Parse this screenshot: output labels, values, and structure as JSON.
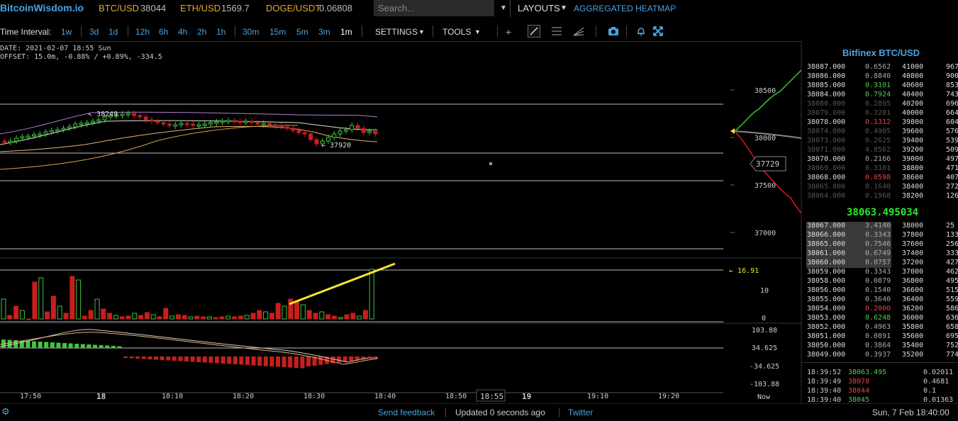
{
  "topbar": {
    "logo": "BitcoinWisdom.io",
    "tickers": [
      {
        "pair": "BTC/USD",
        "price": "38044"
      },
      {
        "pair": "ETH/USD",
        "price": "1569.7"
      },
      {
        "pair": "DOGE/USDT",
        "price": "0.06808"
      }
    ],
    "search_placeholder": "Search...",
    "layouts_label": "LAYOUTS",
    "heatmap_label": "AGGREGATED HEATMAP"
  },
  "toolbar": {
    "time_interval_label": "Time Interval:",
    "intervals": [
      "1w",
      "3d",
      "1d",
      "12h",
      "6h",
      "4h",
      "2h",
      "1h",
      "30m",
      "15m",
      "5m",
      "3m",
      "1m"
    ],
    "selected_interval": "1m",
    "settings_label": "SETTINGS",
    "tools_label": "TOOLS"
  },
  "chart_info": {
    "date_line": "DATE: 2021-02-07 18:55 Sun",
    "offset_line": "OFFSET: 15.0m, -0.88% / +0.89%, -334.5"
  },
  "chart": {
    "price_axis": [
      "38500",
      "38000",
      "37500",
      "37000"
    ],
    "high_label": "38249",
    "low_label": "37920",
    "depth_price_label": "37729",
    "volume_axis": [
      "10",
      "0"
    ],
    "volume_marker": "16.91",
    "macd_axis": [
      "103.88",
      "34.625",
      "-34.625",
      "-103.88"
    ],
    "time_axis": [
      "17:50",
      "18",
      "18:10",
      "18:20",
      "18:30",
      "18:40",
      "18:50",
      "18:55",
      "19",
      "19:10",
      "19:20"
    ],
    "now_label": "Now",
    "colors": {
      "up": "#3ec63e",
      "down": "#c81e1e",
      "trendline": "#f5e62a"
    }
  },
  "orderbook": {
    "title": "Bitfinex BTC/USD",
    "asks": [
      {
        "price": "38087.000",
        "amount": "0.6562",
        "total": "41000",
        "sum": "967",
        "dim": false
      },
      {
        "price": "38086.000",
        "amount": "0.8840",
        "total": "40800",
        "sum": "900",
        "dim": false
      },
      {
        "price": "38085.000",
        "amount": "0.3101",
        "total": "40600",
        "sum": "853",
        "dim": false
      },
      {
        "price": "38084.000",
        "amount": "0.7924",
        "total": "40400",
        "sum": "743",
        "dim": false
      },
      {
        "price": "38080.000",
        "amount": "0.2895",
        "total": "40200",
        "sum": "696",
        "dim": true
      },
      {
        "price": "38079.000",
        "amount": "0.3281",
        "total": "40000",
        "sum": "664",
        "dim": true
      },
      {
        "price": "38078.000",
        "amount": "0.1312",
        "total": "39800",
        "sum": "604",
        "dim": false
      },
      {
        "price": "38074.000",
        "amount": "0.4905",
        "total": "39600",
        "sum": "576",
        "dim": true
      },
      {
        "price": "38073.000",
        "amount": "0.2625",
        "total": "39400",
        "sum": "539",
        "dim": true
      },
      {
        "price": "38071.000",
        "amount": "4.8562",
        "total": "39200",
        "sum": "509",
        "dim": true
      },
      {
        "price": "38070.000",
        "amount": "0.2166",
        "total": "39000",
        "sum": "497",
        "dim": false
      },
      {
        "price": "38069.000",
        "amount": "0.3101",
        "total": "38800",
        "sum": "471",
        "dim": true
      },
      {
        "price": "38068.000",
        "amount": "0.0598",
        "total": "38600",
        "sum": "407",
        "dim": false
      },
      {
        "price": "38065.000",
        "amount": "0.1648",
        "total": "38400",
        "sum": "272",
        "dim": true
      },
      {
        "price": "38064.000",
        "amount": "0.1968",
        "total": "38200",
        "sum": "126",
        "dim": true
      }
    ],
    "mid_price": "38063.495034",
    "bids": [
      {
        "price": "38067.000",
        "amount": "3.4140",
        "total": "38000",
        "sum": "25",
        "hl": true
      },
      {
        "price": "38066.000",
        "amount": "0.3343",
        "total": "37800",
        "sum": "133",
        "hl": true
      },
      {
        "price": "38065.000",
        "amount": "0.7546",
        "total": "37600",
        "sum": "256",
        "hl": true
      },
      {
        "price": "38061.000",
        "amount": "0.6749",
        "total": "37400",
        "sum": "333",
        "hl": true
      },
      {
        "price": "38060.000",
        "amount": "0.0757",
        "total": "37200",
        "sum": "427",
        "hl": true
      },
      {
        "price": "38059.000",
        "amount": "0.3343",
        "total": "37000",
        "sum": "462",
        "hl": false
      },
      {
        "price": "38058.000",
        "amount": "0.0879",
        "total": "36800",
        "sum": "495",
        "hl": false
      },
      {
        "price": "38056.000",
        "amount": "0.1540",
        "total": "36600",
        "sum": "515",
        "hl": false
      },
      {
        "price": "38055.000",
        "amount": "0.3640",
        "total": "36400",
        "sum": "559",
        "hl": false
      },
      {
        "price": "38054.000",
        "amount": "0.2000",
        "total": "36200",
        "sum": "586",
        "hl": false
      },
      {
        "price": "38053.000",
        "amount": "0.6248",
        "total": "36000",
        "sum": "636",
        "hl": false
      },
      {
        "price": "38052.000",
        "amount": "0.4963",
        "total": "35800",
        "sum": "658",
        "hl": false
      },
      {
        "price": "38051.000",
        "amount": "0.0891",
        "total": "35600",
        "sum": "695",
        "hl": false
      },
      {
        "price": "38050.000",
        "amount": "0.3864",
        "total": "35400",
        "sum": "752",
        "hl": false
      },
      {
        "price": "38049.000",
        "amount": "0.3937",
        "total": "35200",
        "sum": "774",
        "hl": false
      }
    ],
    "trades": [
      {
        "time": "18:39:52",
        "price": "38063.495",
        "amount": "0.02011",
        "side": "buy"
      },
      {
        "time": "18:39:49",
        "price": "38070",
        "amount": "0.4681",
        "side": "sell"
      },
      {
        "time": "18:39:40",
        "price": "38044",
        "amount": "0.1",
        "side": "sell"
      },
      {
        "time": "18:39:40",
        "price": "38045",
        "amount": "0.01363",
        "side": "buy"
      }
    ]
  },
  "footer": {
    "feedback": "Send feedback",
    "updated": "Updated 0 seconds ago",
    "twitter": "Twitter",
    "datetime": "Sun, 7 Feb 18:40:00"
  }
}
